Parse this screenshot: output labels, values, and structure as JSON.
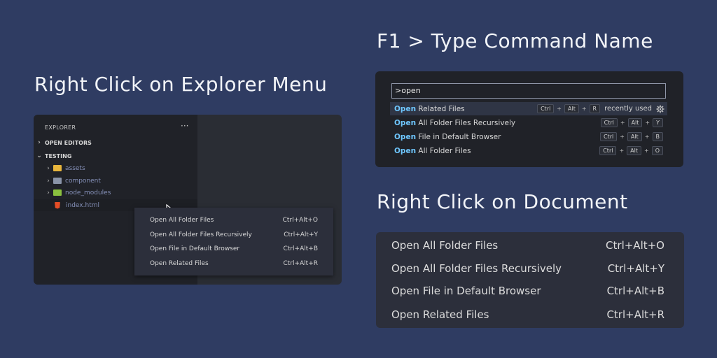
{
  "headings": {
    "explorer": "Right Click on Explorer Menu",
    "palette": "F1 > Type Command Name",
    "document": "Right Click on Document"
  },
  "explorer": {
    "title": "EXPLORER",
    "more": "···",
    "sections": {
      "open_editors": "OPEN EDITORS",
      "testing": "TESTING"
    },
    "items": [
      {
        "label": "assets",
        "icon": "folder-yellow-icon"
      },
      {
        "label": "component",
        "icon": "folder-icon"
      },
      {
        "label": "node_modules",
        "icon": "folder-node-icon"
      },
      {
        "label": "index.html",
        "icon": "html5-icon"
      }
    ],
    "context_menu": [
      {
        "label": "Open All Folder Files",
        "shortcut": "Ctrl+Alt+O"
      },
      {
        "label": "Open All Folder Files Recursively",
        "shortcut": "Ctrl+Alt+Y"
      },
      {
        "label": "Open File in Default Browser",
        "shortcut": "Ctrl+Alt+B"
      },
      {
        "label": "Open Related Files",
        "shortcut": "Ctrl+Alt+R"
      }
    ]
  },
  "palette": {
    "input_value": ">open",
    "match": "Open",
    "recent": "recently used",
    "rows": [
      {
        "rest": " Related Files",
        "keys": [
          "Ctrl",
          "Alt",
          "R"
        ]
      },
      {
        "rest": " All Folder Files Recursively",
        "keys": [
          "Ctrl",
          "Alt",
          "Y"
        ]
      },
      {
        "rest": " File in Default Browser",
        "keys": [
          "Ctrl",
          "Alt",
          "B"
        ]
      },
      {
        "rest": " All Folder Files",
        "keys": [
          "Ctrl",
          "Alt",
          "O"
        ]
      }
    ],
    "plus": "+"
  },
  "document_menu": [
    {
      "label": "Open All Folder Files",
      "shortcut": "Ctrl+Alt+O"
    },
    {
      "label": "Open All Folder Files Recursively",
      "shortcut": "Ctrl+Alt+Y"
    },
    {
      "label": "Open File in Default Browser",
      "shortcut": "Ctrl+Alt+B"
    },
    {
      "label": "Open Related Files",
      "shortcut": "Ctrl+Alt+R"
    }
  ],
  "colors": {
    "background": "#2f3c62",
    "accent": "#6fc7ff"
  }
}
